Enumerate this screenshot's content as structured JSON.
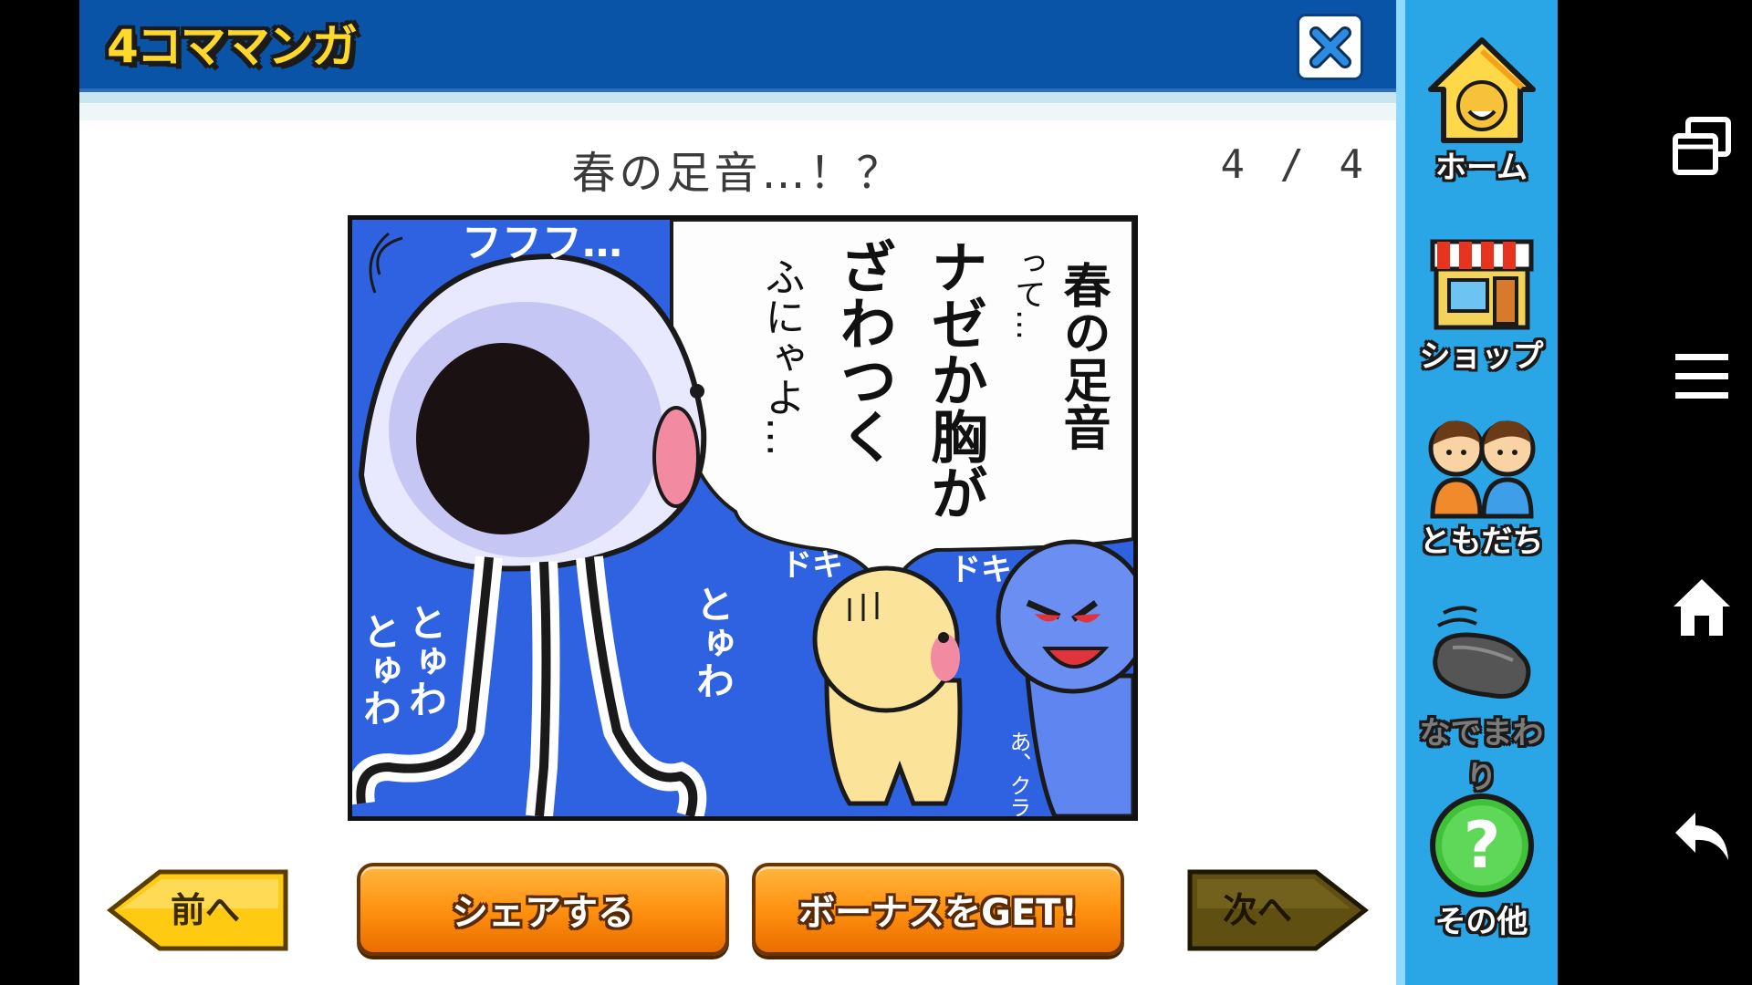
{
  "header": {
    "logo_text": "4コママンガ",
    "close_label": "✕"
  },
  "comic": {
    "title": "春の足音…！？",
    "page_current": "4",
    "page_total": "4",
    "page_indicator": "4 / 4",
    "panel_text": {
      "speech_col1": "春の足音",
      "speech_col2": "って…",
      "speech_col3": "ナゼか胸が",
      "speech_col4": "ざわつく",
      "speech_col5": "ふにゃよ…",
      "sfx_fufufu": "フフフ…",
      "sfx_doki1": "ドキ",
      "sfx_doki2": "ドキ",
      "sfx_toyuwa_left1": "とゅわ",
      "sfx_toyuwa_left2": "とゅわ",
      "sfx_toyuwa_right": "とゅわ",
      "sfx_aa_kurage": "あ、クラゲ"
    }
  },
  "buttons": {
    "prev": "前へ",
    "share": "シェアする",
    "bonus": "ボーナスをGET!",
    "next": "次へ"
  },
  "sidebar": {
    "items": [
      {
        "label": "ホーム",
        "icon": "home-icon"
      },
      {
        "label": "ショップ",
        "icon": "shop-icon"
      },
      {
        "label": "ともだち",
        "icon": "friends-icon"
      },
      {
        "label": "なでまわり",
        "icon": "petting-hand-icon"
      },
      {
        "label": "その他",
        "icon": "help-icon"
      }
    ]
  },
  "colors": {
    "header_blue": "#0a54a8",
    "sidebar_blue": "#2aa5e6",
    "orange_button": "#ff9210",
    "prev_yellow": "#ffcb12",
    "next_olive": "#5f4f10",
    "comic_blue": "#2f62e0"
  }
}
